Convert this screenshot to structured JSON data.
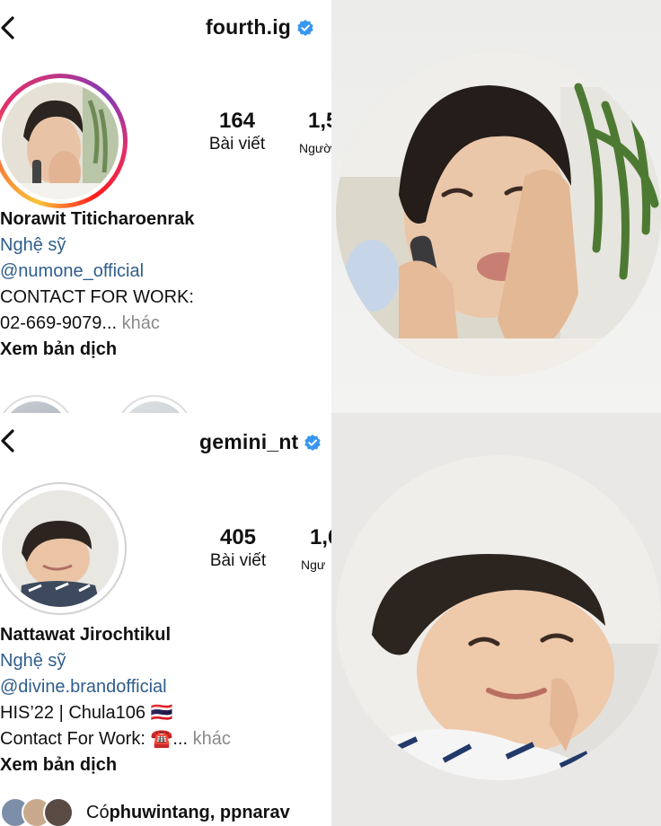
{
  "profile_top": {
    "username": "fourth.ig",
    "posts_count": "164",
    "posts_label": "Bài viết",
    "followers_count_partial": "1,5",
    "followers_label_partial": "Ngườ",
    "full_name": "Norawit Titicharoenrak",
    "category": "Nghệ sỹ",
    "link": "@numone_official",
    "bio_line1": "CONTACT FOR WORK:",
    "bio_line2": "02-669-9079...",
    "more_label": " khác",
    "translate_label": "Xem bản dịch"
  },
  "profile_bottom": {
    "username": "gemini_nt",
    "posts_count": "405",
    "posts_label": "Bài viết",
    "followers_count_partial": "1,6",
    "followers_label_partial": "Ngư",
    "full_name": "Nattawat Jirochtikul",
    "category": "Nghệ sỹ",
    "link": "@divine.brandofficial",
    "bio_line1": "HIS’22 | Chula106 🇹🇭",
    "bio_line2": "Contact For Work: ☎️...",
    "more_label": " khác",
    "translate_label": "Xem bản dịch",
    "followed_by_prefix": "Có ",
    "followed_by_names": "phuwintang, ppnarav"
  },
  "colors": {
    "verified": "#3897f0",
    "link": "#2f5d8c",
    "muted": "#8a8a8a"
  },
  "icons": [
    "back-arrow-icon",
    "verified-badge-icon"
  ]
}
